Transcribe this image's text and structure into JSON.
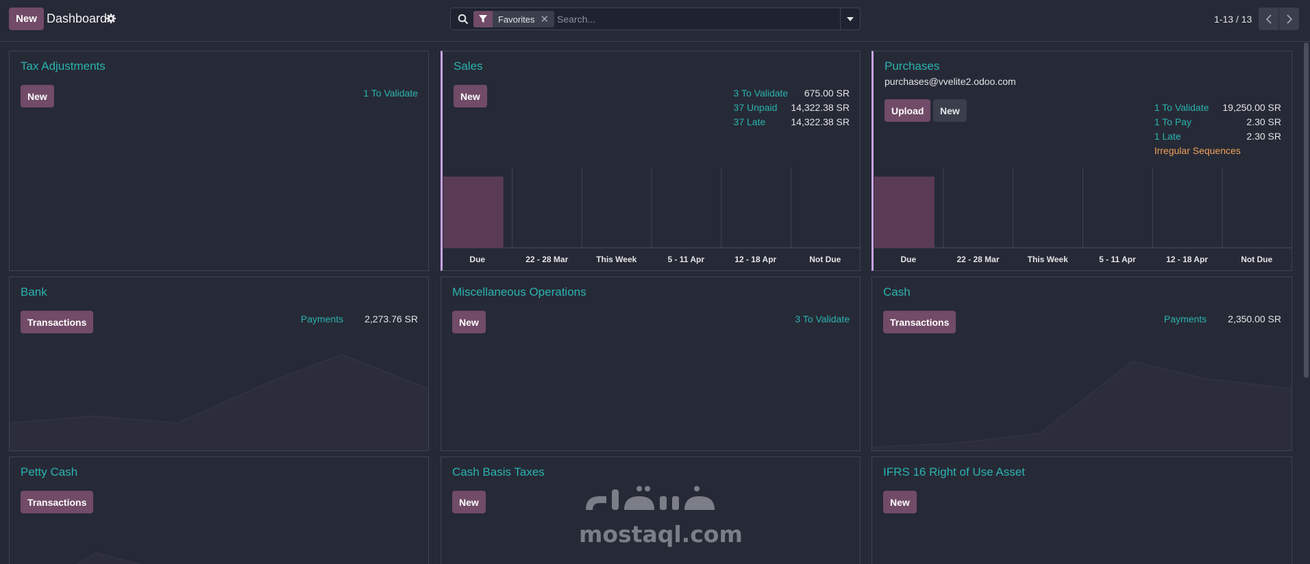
{
  "topbar": {
    "new_label": "New",
    "title": "Dashboard",
    "search": {
      "facet_label": "Favorites",
      "placeholder": "Search..."
    },
    "pager": "1-13 / 13"
  },
  "cards": {
    "tax": {
      "title": "Tax Adjustments",
      "new_label": "New",
      "validate": "1 To Validate"
    },
    "sales": {
      "title": "Sales",
      "new_label": "New",
      "stats": [
        {
          "label": "3 To Validate",
          "value": "675.00 SR"
        },
        {
          "label": "37 Unpaid",
          "value": "14,322.38 SR"
        },
        {
          "label": "37 Late",
          "value": "14,322.38 SR"
        }
      ]
    },
    "purchases": {
      "title": "Purchases",
      "email": "purchases@vvelite2.odoo.com",
      "upload_label": "Upload",
      "new_label": "New",
      "stats": [
        {
          "label": "1 To Validate",
          "value": "19,250.00 SR"
        },
        {
          "label": "1 To Pay",
          "value": "2.30 SR"
        },
        {
          "label": "1 Late",
          "value": "2.30 SR"
        }
      ],
      "irregular": "Irregular Sequences"
    },
    "bank": {
      "title": "Bank",
      "button_label": "Transactions",
      "payments_label": "Payments",
      "payments_value": "2,273.76 SR"
    },
    "misc": {
      "title": "Miscellaneous Operations",
      "new_label": "New",
      "validate": "3 To Validate"
    },
    "cash": {
      "title": "Cash",
      "button_label": "Transactions",
      "payments_label": "Payments",
      "payments_value": "2,350.00 SR"
    },
    "petty": {
      "title": "Petty Cash",
      "button_label": "Transactions"
    },
    "cbt": {
      "title": "Cash Basis Taxes",
      "new_label": "New"
    },
    "ifrs": {
      "title": "IFRS 16 Right of Use Asset",
      "new_label": "New"
    }
  },
  "chart_data": [
    {
      "type": "bar",
      "categories": [
        "Due",
        "22 - 28 Mar",
        "This Week",
        "5 - 11 Apr",
        "12 - 18 Apr",
        "Not Due"
      ],
      "values": [
        1,
        0,
        0,
        0,
        0,
        0
      ]
    },
    {
      "type": "bar",
      "categories": [
        "Due",
        "22 - 28 Mar",
        "This Week",
        "5 - 11 Apr",
        "12 - 18 Apr",
        "Not Due"
      ],
      "values": [
        1,
        0,
        0,
        0,
        0,
        0
      ]
    }
  ],
  "watermark": {
    "text": "mostaql.com"
  },
  "colors": {
    "accent": "#714b67",
    "teal": "#2ab3b0",
    "orange": "#f0a05a",
    "background": "#262a36"
  }
}
